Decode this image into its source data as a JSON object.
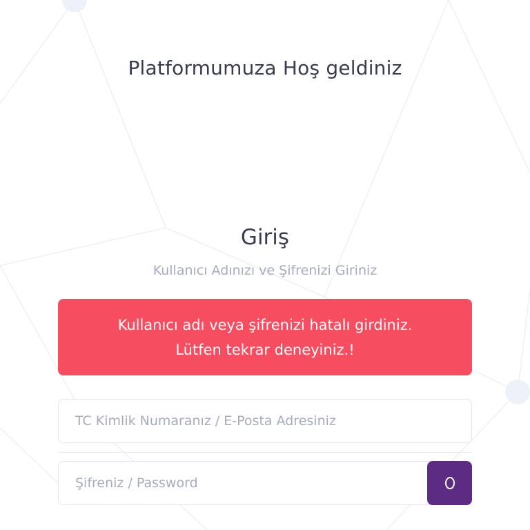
{
  "header": {
    "welcome_title": "Platformumuza Hoş geldiniz"
  },
  "login": {
    "title": "Giriş",
    "subtitle": "Kullanıcı Adınızı ve Şifrenizi Giriniz",
    "error": {
      "line1": "Kullanıcı adı veya şifrenizi hatalı girdiniz.",
      "line2": "Lütfen tekrar deneyiniz.!"
    },
    "username": {
      "placeholder": "TC Kimlik Numaranız / E-Posta Adresiniz",
      "value": ""
    },
    "password": {
      "placeholder": "Şifreniz / Password",
      "value": ""
    },
    "toggle_icon": "eye-icon"
  },
  "colors": {
    "background": "#ffffff",
    "text": "#3a3d4f",
    "muted": "#a7abc0",
    "error": "#f64e60",
    "accent": "#5c2c85",
    "border": "#e4e6ef"
  }
}
